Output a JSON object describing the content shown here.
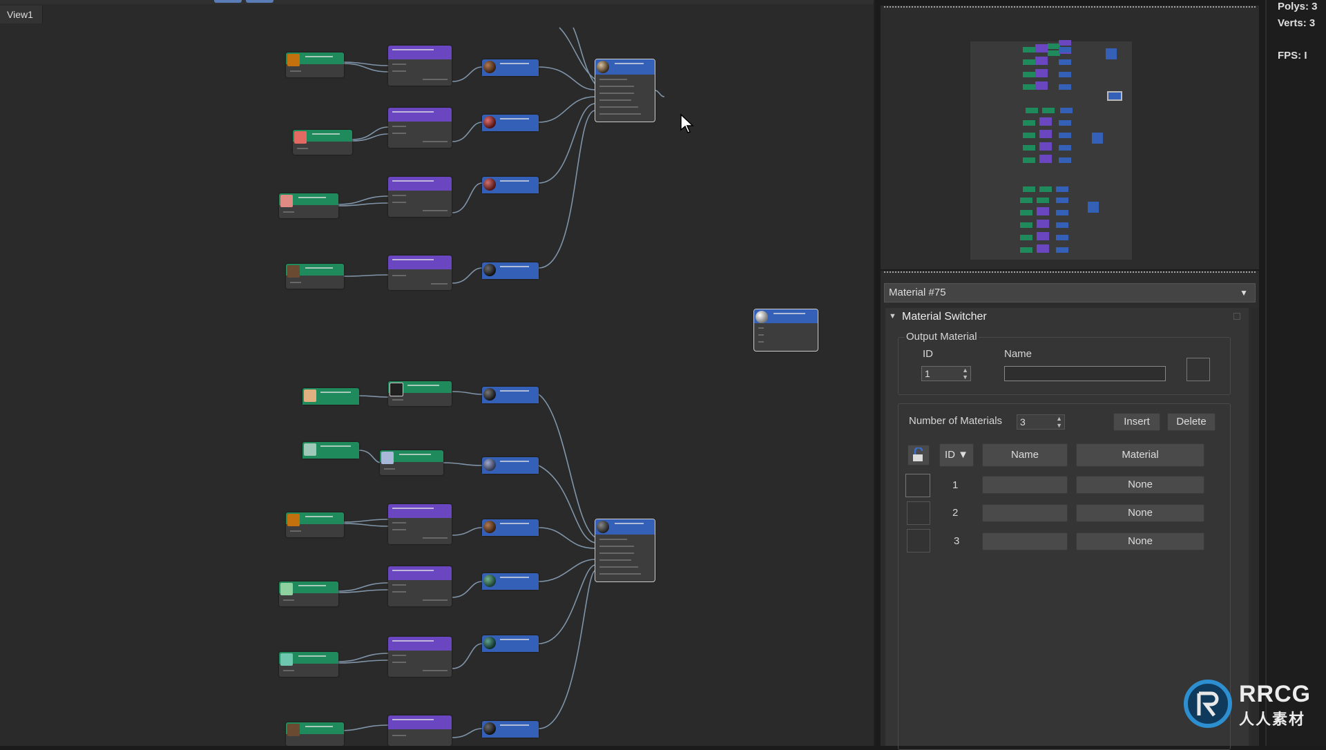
{
  "viewport": {
    "tab_label": "View1"
  },
  "material_panel": {
    "dropdown_label": "Material #75",
    "rollout_title": "Material Switcher",
    "output_group_label": "Output Material",
    "id_label": "ID",
    "name_label": "Name",
    "id_value": "1",
    "name_value": "",
    "number_of_materials_label": "Number of Materials",
    "number_of_materials_value": "3",
    "insert_label": "Insert",
    "delete_label": "Delete",
    "table_headers": {
      "id": "ID ▼",
      "name": "Name",
      "material": "Material"
    },
    "rows": [
      {
        "id": "1",
        "name": "",
        "material": "None"
      },
      {
        "id": "2",
        "name": "",
        "material": "None"
      },
      {
        "id": "3",
        "name": "",
        "material": "None"
      }
    ]
  },
  "stats": {
    "polys": "Polys: 3",
    "verts": "Verts: 3",
    "fps": "FPS:   I"
  },
  "watermark": {
    "line1": "RRCG",
    "line2": "人人素材"
  },
  "icons": {
    "cursor": "mouse-pointer-icon",
    "collapse": "triangle-down-icon",
    "lock": "unlock-icon"
  }
}
